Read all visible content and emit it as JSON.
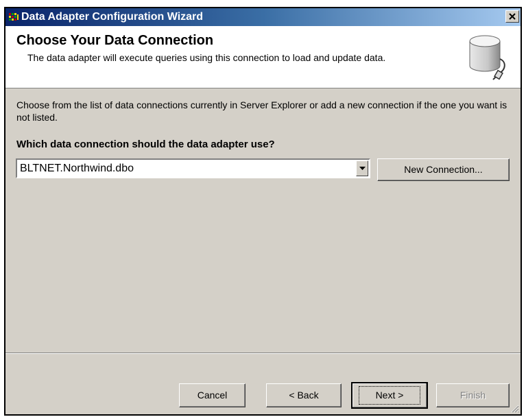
{
  "window": {
    "title": "Data Adapter Configuration Wizard",
    "close_glyph": "close-icon"
  },
  "header": {
    "title": "Choose Your Data Connection",
    "description": "The data adapter will execute queries using this connection to load and update data.",
    "icon": "database-connection-icon"
  },
  "body": {
    "intro": "Choose from the list of data connections currently in Server Explorer or add a new connection if the one you want is not listed.",
    "question": "Which data connection should the data adapter use?",
    "connection_select": {
      "value": "BLTNET.Northwind.dbo"
    },
    "new_connection_label": "New Connection..."
  },
  "footer": {
    "cancel_label": "Cancel",
    "back_label": "< Back",
    "next_label": "Next >",
    "finish_label": "Finish"
  },
  "colors": {
    "title_gradient_start": "#0a246a",
    "title_gradient_end": "#a6caf0",
    "dialog_face": "#d4d0c8",
    "header_bg": "#ffffff",
    "disabled_text": "#808080"
  }
}
